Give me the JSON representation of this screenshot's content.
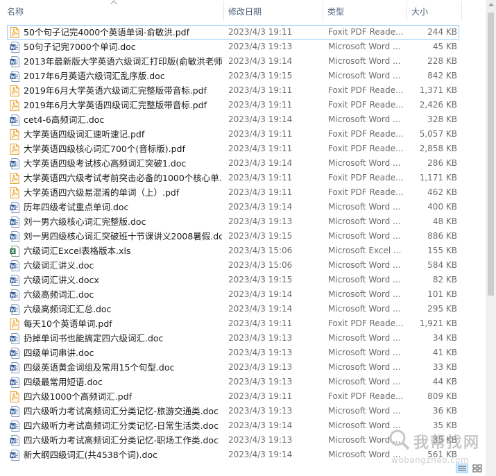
{
  "header": {
    "name_label": "名称",
    "date_label": "修改日期",
    "type_label": "类型",
    "size_label": "大小"
  },
  "files": [
    {
      "name": "50个句子记完4000个英语单词-俞敏洪.pdf",
      "date": "2023/4/3 19:11",
      "type": "Foxit PDF Reade...",
      "size": "244 KB",
      "kind": "pdf"
    },
    {
      "name": "50句子记完7000个单词.doc",
      "date": "2023/4/3 19:13",
      "type": "Microsoft Word ...",
      "size": "45 KB",
      "kind": "doc"
    },
    {
      "name": "2013年最新版大学英语六级词汇打印版(俞敏洪老师...",
      "date": "2023/4/3 19:14",
      "type": "Microsoft Word ...",
      "size": "228 KB",
      "kind": "doc"
    },
    {
      "name": "2017年6月英语六级词汇乱序版.doc",
      "date": "2023/4/3 19:15",
      "type": "Microsoft Word ...",
      "size": "842 KB",
      "kind": "doc"
    },
    {
      "name": "2019年6月大学英语六级词汇完整版带音标.pdf",
      "date": "2023/4/3 19:11",
      "type": "Foxit PDF Reade...",
      "size": "1,371 KB",
      "kind": "pdf"
    },
    {
      "name": "2019年6月大学英语四级词汇完整版带音标.pdf",
      "date": "2023/4/3 19:11",
      "type": "Foxit PDF Reade...",
      "size": "2,426 KB",
      "kind": "pdf"
    },
    {
      "name": "cet4-6高频词汇.doc",
      "date": "2023/4/3 19:14",
      "type": "Microsoft Word ...",
      "size": "328 KB",
      "kind": "doc"
    },
    {
      "name": "大学英语四级词汇速听速记.pdf",
      "date": "2023/4/3 19:11",
      "type": "Foxit PDF Reade...",
      "size": "5,057 KB",
      "kind": "pdf"
    },
    {
      "name": "大学英语四级核心词汇700个(音标版).pdf",
      "date": "2023/4/3 19:11",
      "type": "Foxit PDF Reade...",
      "size": "2,858 KB",
      "kind": "pdf"
    },
    {
      "name": "大学英语四级考试核心高频词汇突破1.doc",
      "date": "2023/4/3 19:14",
      "type": "Microsoft Word ...",
      "size": "286 KB",
      "kind": "doc"
    },
    {
      "name": "大学英语四六级考试考前突击必备的1000个核心单...",
      "date": "2023/4/3 19:11",
      "type": "Foxit PDF Reade...",
      "size": "1,171 KB",
      "kind": "pdf"
    },
    {
      "name": "大学英语四六级易混淆的单词（上）.pdf",
      "date": "2023/4/3 19:11",
      "type": "Foxit PDF Reade...",
      "size": "462 KB",
      "kind": "pdf"
    },
    {
      "name": "历年四级考试重点单词.doc",
      "date": "2023/4/3 19:14",
      "type": "Microsoft Word ...",
      "size": "400 KB",
      "kind": "doc"
    },
    {
      "name": "刘一男六级核心词汇完整版.doc",
      "date": "2023/4/3 19:13",
      "type": "Microsoft Word ...",
      "size": "48 KB",
      "kind": "doc"
    },
    {
      "name": "刘一男四级核心词汇突破班十节课讲义2008暑假.doc",
      "date": "2023/4/3 19:15",
      "type": "Microsoft Word ...",
      "size": "886 KB",
      "kind": "doc"
    },
    {
      "name": "六级词汇Excel表格版本.xls",
      "date": "2023/4/3 15:06",
      "type": "Microsoft Excel ...",
      "size": "155 KB",
      "kind": "xls"
    },
    {
      "name": "六级词汇讲义.doc",
      "date": "2023/4/3 15:06",
      "type": "Microsoft Word ...",
      "size": "584 KB",
      "kind": "doc"
    },
    {
      "name": "六级词汇讲义.docx",
      "date": "2023/4/3 19:15",
      "type": "Microsoft Word ...",
      "size": "82 KB",
      "kind": "doc"
    },
    {
      "name": "六级高频词汇.doc",
      "date": "2023/4/3 19:14",
      "type": "Microsoft Word ...",
      "size": "101 KB",
      "kind": "doc"
    },
    {
      "name": "六级高频词汇汇总.doc",
      "date": "2023/4/3 19:14",
      "type": "Microsoft Word ...",
      "size": "295 KB",
      "kind": "doc"
    },
    {
      "name": "每天10个英语单词.pdf",
      "date": "2023/4/3 19:11",
      "type": "Foxit PDF Reade...",
      "size": "1,921 KB",
      "kind": "pdf"
    },
    {
      "name": "扔掉单词书也能搞定四六级词汇.doc",
      "date": "2023/4/3 19:13",
      "type": "Microsoft Word ...",
      "size": "34 KB",
      "kind": "doc"
    },
    {
      "name": "四级单词串讲.doc",
      "date": "2023/4/3 19:13",
      "type": "Microsoft Word ...",
      "size": "41 KB",
      "kind": "doc"
    },
    {
      "name": "四级英语黄金词组及常用15个句型.doc",
      "date": "2023/4/3 19:13",
      "type": "Microsoft Word ...",
      "size": "33 KB",
      "kind": "doc"
    },
    {
      "name": "四级最常用短语.doc",
      "date": "2023/4/3 19:13",
      "type": "Microsoft Word ...",
      "size": "44 KB",
      "kind": "doc"
    },
    {
      "name": "四六级1000个高频词汇.pdf",
      "date": "2023/4/3 19:11",
      "type": "Foxit PDF Reade...",
      "size": "809 KB",
      "kind": "pdf"
    },
    {
      "name": "四六级听力考试高频词汇分类记忆-旅游交通类.doc",
      "date": "2023/4/3 19:13",
      "type": "Microsoft Word ...",
      "size": "36 KB",
      "kind": "doc"
    },
    {
      "name": "四六级听力考试高频词汇分类记忆-日常生活类.doc",
      "date": "2023/4/3 19:14",
      "type": "Microsoft Word ...",
      "size": "35 KB",
      "kind": "doc"
    },
    {
      "name": "四六级听力考试高频词汇分类记忆-职场工作类.doc",
      "date": "2023/4/3 19:13",
      "type": "Microsoft Word ...",
      "size": "35 KB",
      "kind": "doc"
    },
    {
      "name": "新大纲四级词汇(共4538个词).doc",
      "date": "2023/4/3 19:14",
      "type": "Microsoft Word ...",
      "size": "561 KB",
      "kind": "doc"
    }
  ],
  "selected_index": 0,
  "icons": {
    "pdf": "pdf-file-icon",
    "doc": "word-doc-icon",
    "xls": "excel-sheet-icon"
  },
  "colors": {
    "pdf_icon": "#e8a33d",
    "doc_icon": "#2b5797",
    "xls_icon": "#217346",
    "selection_border": "#99d1ff",
    "header_text": "#4c607a"
  },
  "watermark": {
    "text": "我帮找网",
    "url": "wobangzhao.com"
  }
}
